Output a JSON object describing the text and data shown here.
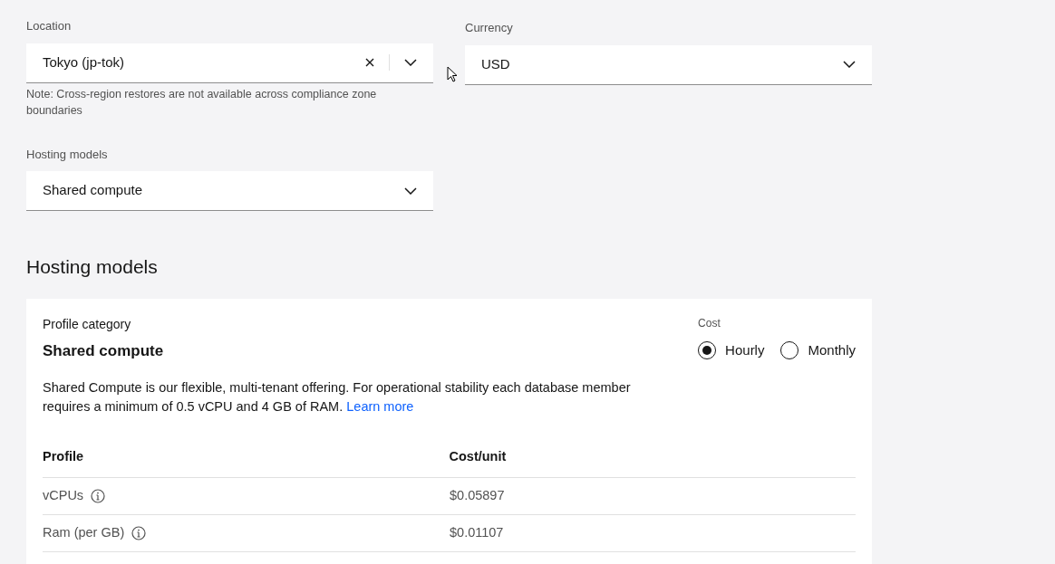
{
  "location": {
    "label": "Location",
    "value": "Tokyo (jp-tok)",
    "note": "Note: Cross-region restores are not available across compliance zone boundaries"
  },
  "currency": {
    "label": "Currency",
    "value": "USD"
  },
  "hosting_select": {
    "label": "Hosting models",
    "value": "Shared compute"
  },
  "section_title": "Hosting models",
  "card": {
    "category_label": "Profile category",
    "category": "Shared compute",
    "cost_label": "Cost",
    "cost_options": [
      {
        "label": "Hourly",
        "selected": true
      },
      {
        "label": "Monthly",
        "selected": false
      }
    ],
    "description": "Shared Compute is our flexible, multi-tenant offering. For operational stability each database member requires a minimum of 0.5 vCPU and 4 GB of RAM.",
    "link": "Learn more",
    "table": {
      "columns": [
        "Profile",
        "Cost/unit"
      ],
      "rows": [
        {
          "profile": "vCPUs",
          "cost": "$0.05897"
        },
        {
          "profile": "Ram (per GB)",
          "cost": "$0.01107"
        }
      ]
    }
  }
}
